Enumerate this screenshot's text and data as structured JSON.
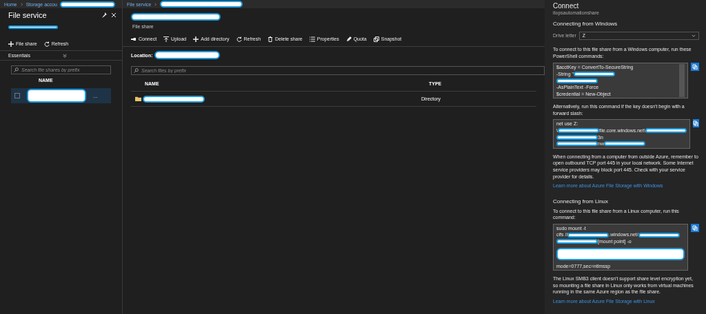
{
  "breadcrumb": {
    "items": [
      "Home",
      "Storage accou"
    ],
    "current": "File service"
  },
  "left_blade": {
    "title": "File service",
    "toolbar": [
      {
        "label": "File share"
      },
      {
        "label": "Refresh"
      }
    ],
    "essentials": {
      "label": "Essentials",
      "expanded": false
    },
    "search": {
      "placeholder": "Search file shares by prefix"
    },
    "columns": [
      "NAME"
    ],
    "rows": [
      {
        "selected": true,
        "checked": false,
        "more": "..."
      }
    ]
  },
  "file_share": {
    "subtitle": "File share",
    "toolbar": [
      {
        "label": "Connect"
      },
      {
        "label": "Upload"
      },
      {
        "label": "Add directory"
      },
      {
        "label": "Refresh"
      },
      {
        "label": "Delete share"
      },
      {
        "label": "Properties"
      },
      {
        "label": "Quota"
      },
      {
        "label": "Snapshot"
      }
    ],
    "location_label": "Location:",
    "search": {
      "placeholder": "Search files by prefix"
    },
    "columns": [
      "NAME",
      "TYPE"
    ],
    "rows": [
      {
        "type": "Directory"
      }
    ]
  },
  "connect": {
    "title": "Connect",
    "subtitle": "itopsautomationshare",
    "windows": {
      "heading": "Connecting from Windows",
      "drive_label": "Drive letter",
      "drive_value": "Z",
      "intro": "To connect to this file share from a Windows computer, run these PowerShell commands:",
      "code": [
        [
          {
            "kind": "text",
            "text": "$acctKey = ConvertTo-SecureString"
          }
        ],
        [
          {
            "kind": "text",
            "text": "-String \""
          },
          {
            "kind": "redacted"
          }
        ],
        [
          {
            "kind": "redacted"
          }
        ],
        [
          {
            "kind": "text",
            "text": " -AsPlainText -Force"
          }
        ],
        [
          {
            "kind": "text",
            "text": "$credential = New-Object"
          }
        ]
      ],
      "alt_intro": "Alternatively, run this command if the key doesn't begin with a forward slash:",
      "alt_code": [
        [
          {
            "kind": "text",
            "text": "net use Z:"
          }
        ],
        [
          {
            "kind": "text",
            "text": "\\"
          },
          {
            "kind": "redacted"
          },
          {
            "kind": "text",
            "text": "file.core.windows.net\\"
          },
          {
            "kind": "redacted"
          }
        ],
        [
          {
            "kind": "redacted"
          },
          {
            "kind": "text",
            "text": "3n"
          }
        ],
        [
          {
            "kind": "redacted"
          },
          {
            "kind": "text",
            "text": "nw"
          },
          {
            "kind": "redacted"
          }
        ]
      ],
      "note": "When connecting from a computer from outside Azure, remember to open outbound TCP port 445 in your local network. Some Internet service providers may block port 445. Check with your service provider for details.",
      "link": "Learn more about Azure File Storage with Windows"
    },
    "linux": {
      "heading": "Connecting from Linux",
      "intro": "To connect to this file share from a Linux computer, run this command:",
      "code": [
        [
          {
            "kind": "text",
            "text": "sudo mount -t"
          }
        ],
        [
          {
            "kind": "text",
            "text": "cifs //"
          },
          {
            "kind": "redacted"
          },
          {
            "kind": "text",
            "text": ".windows.net/"
          },
          {
            "kind": "redacted"
          }
        ],
        [
          {
            "kind": "redacted"
          },
          {
            "kind": "text",
            "text": " [mount point] -o"
          }
        ],
        [
          {
            "kind": "block"
          }
        ],
        [
          {
            "kind": "text",
            "text": "mode=0777,sec=ntlmssp"
          }
        ]
      ],
      "note": "The Linux SMB3 client doesn't support share level encryption yet, so mounting a file share in Linux only works from virtual machines running in the same Azure region as the file share.",
      "link": "Learn more about Azure File Storage with Linux"
    }
  }
}
